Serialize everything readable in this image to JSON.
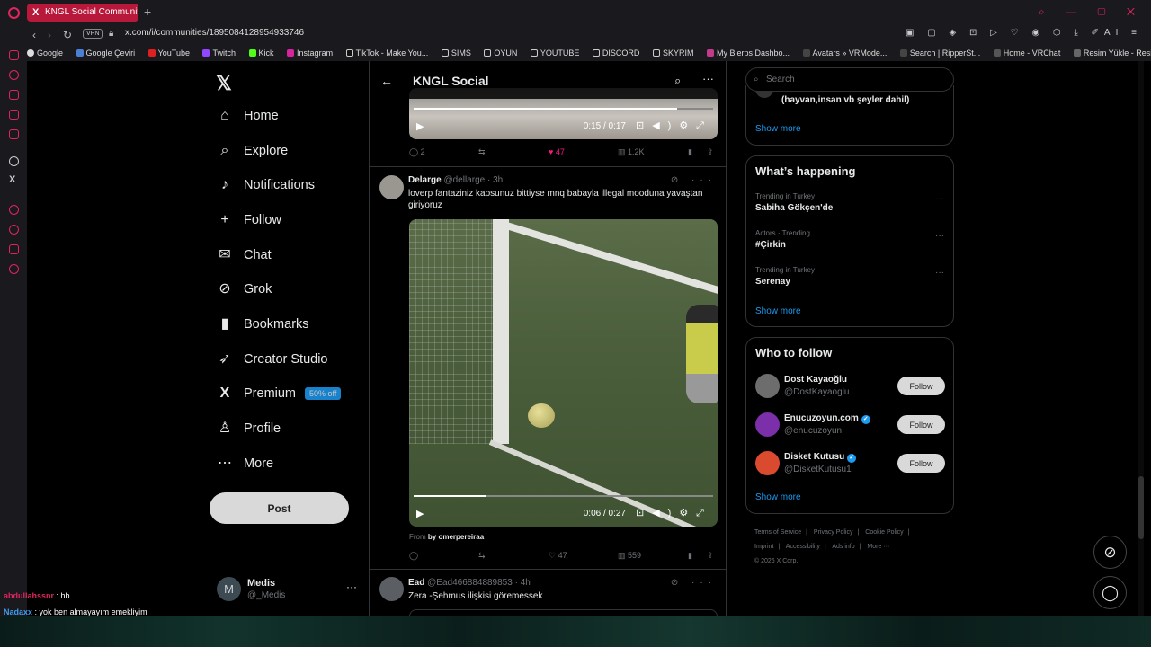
{
  "browser": {
    "tab_title": "KNGL Social Community /",
    "url": "x.com/i/communities/1895084128954933746",
    "vpn_label": "VPN",
    "bookmarks": [
      "Google",
      "Google Çeviri",
      "YouTube",
      "Twitch",
      "Kick",
      "Instagram",
      "TikTok - Make You...",
      "SIMS",
      "OYUN",
      "YOUTUBE",
      "DISCORD",
      "SKYRIM",
      "My Bierps Dashbo...",
      "Avatars » VRMode...",
      "Search | RipperSt...",
      "Home - VRChat",
      "Resim Yükle - Resi..."
    ],
    "ai_label": "AI"
  },
  "nav": {
    "items": [
      {
        "label": "Home",
        "icon": "⌂"
      },
      {
        "label": "Explore",
        "icon": "⌕"
      },
      {
        "label": "Notifications",
        "icon": "♪"
      },
      {
        "label": "Follow",
        "icon": "+"
      },
      {
        "label": "Chat",
        "icon": "✉"
      },
      {
        "label": "Grok",
        "icon": "⊘"
      },
      {
        "label": "Bookmarks",
        "icon": "▮"
      },
      {
        "label": "Creator Studio",
        "icon": "➶"
      },
      {
        "label": "Premium",
        "icon": "X"
      },
      {
        "label": "Profile",
        "icon": "♙"
      },
      {
        "label": "More",
        "icon": "⋯"
      }
    ],
    "premium_badge": "50% off",
    "post_label": "Post",
    "account": {
      "initial": "M",
      "name": "Medis",
      "handle": "@_Medis"
    }
  },
  "feed": {
    "title": "KNGL Social",
    "tweet1": {
      "video_time": "0:15 / 0:17",
      "progress": 0.88,
      "replies": "2",
      "likes": "47",
      "views": "1.2K"
    },
    "tweet2": {
      "name": "Delarge",
      "handle": "@dellarge · 3h",
      "text": "loverp fantaziniz kaosunuz bittiyse mnq babayla illegal mooduna yavaştan giriyoruz",
      "video_time": "0:06 / 0:27",
      "progress": 0.24,
      "from_prefix": "From",
      "from_user": "by omerpereiraa",
      "likes": "47",
      "views": "559"
    },
    "tweet3": {
      "name": "Ead",
      "handle": "@Ead466884889853 · 4h",
      "text": "Zera -Şehmus ilişkisi göremessek"
    }
  },
  "right": {
    "search_placeholder": "Search",
    "community_item": "(hayvan,insan vb şeyler dahil)",
    "show_more": "Show more",
    "happening_title": "What’s happening",
    "trends": [
      {
        "context": "Trending in Turkey",
        "name": "Sabiha Gökçen'de"
      },
      {
        "context": "Actors · Trending",
        "name": "#Çirkin"
      },
      {
        "context": "Trending in Turkey",
        "name": "Serenay"
      }
    ],
    "who_title": "Who to follow",
    "who": [
      {
        "name": "Dost Kayaoğlu",
        "handle": "@DostKayaoglu",
        "verified": false,
        "color": "#6d6d6d"
      },
      {
        "name": "Enucuzoyun.com",
        "handle": "@enucuzoyun",
        "verified": true,
        "color": "#7b2fa8"
      },
      {
        "name": "Disket Kutusu",
        "handle": "@DisketKutusu1",
        "verified": true,
        "color": "#d94a2e"
      }
    ],
    "follow_label": "Follow",
    "footer": [
      "Terms of Service",
      "|",
      "Privacy Policy",
      "|",
      "Cookie Policy",
      "|",
      "Imprint",
      "|",
      "Accessibility",
      "|",
      "Ads info",
      "|",
      "More ···",
      "© 2026 X Corp."
    ]
  },
  "chat": {
    "line1_user": "abdullahssnr",
    "line1_text": ": hb",
    "line2_user": "Nadaxx",
    "line2_text": ": yok ben almayayım emekliyim"
  }
}
